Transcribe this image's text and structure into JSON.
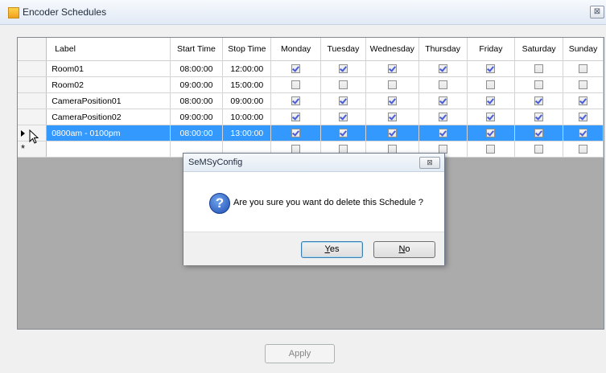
{
  "window": {
    "title": "Encoder Schedules",
    "close_glyph": "⊠"
  },
  "grid": {
    "columns": [
      "Label",
      "Start Time",
      "Stop Time",
      "Monday",
      "Tuesday",
      "Wednesday",
      "Thursday",
      "Friday",
      "Saturday",
      "Sunday"
    ],
    "rows": [
      {
        "label": "Room01",
        "start": "08:00:00",
        "stop": "12:00:00",
        "days": [
          true,
          true,
          true,
          true,
          true,
          false,
          false
        ]
      },
      {
        "label": "Room02",
        "start": "09:00:00",
        "stop": "15:00:00",
        "days": [
          false,
          false,
          false,
          false,
          false,
          false,
          false
        ]
      },
      {
        "label": "CameraPosition01",
        "start": "08:00:00",
        "stop": "09:00:00",
        "days": [
          true,
          true,
          true,
          true,
          true,
          true,
          true
        ]
      },
      {
        "label": "CameraPosition02",
        "start": "09:00:00",
        "stop": "10:00:00",
        "days": [
          true,
          true,
          true,
          true,
          true,
          true,
          true
        ]
      },
      {
        "label": "0800am - 0100pm",
        "start": "08:00:00",
        "stop": "13:00:00",
        "days": [
          true,
          true,
          true,
          true,
          true,
          true,
          true
        ],
        "selected": true
      }
    ],
    "new_row_marker": "*",
    "selected_row_indicator": "arrow-right-icon"
  },
  "apply_button": {
    "label": "Apply"
  },
  "dialog": {
    "title": "SeMSyConfig",
    "close_glyph": "⊠",
    "icon": "question-icon",
    "icon_glyph": "?",
    "message": "Are you sure you want do delete this Schedule ?",
    "yes_label": "Yes",
    "no_label": "No"
  }
}
